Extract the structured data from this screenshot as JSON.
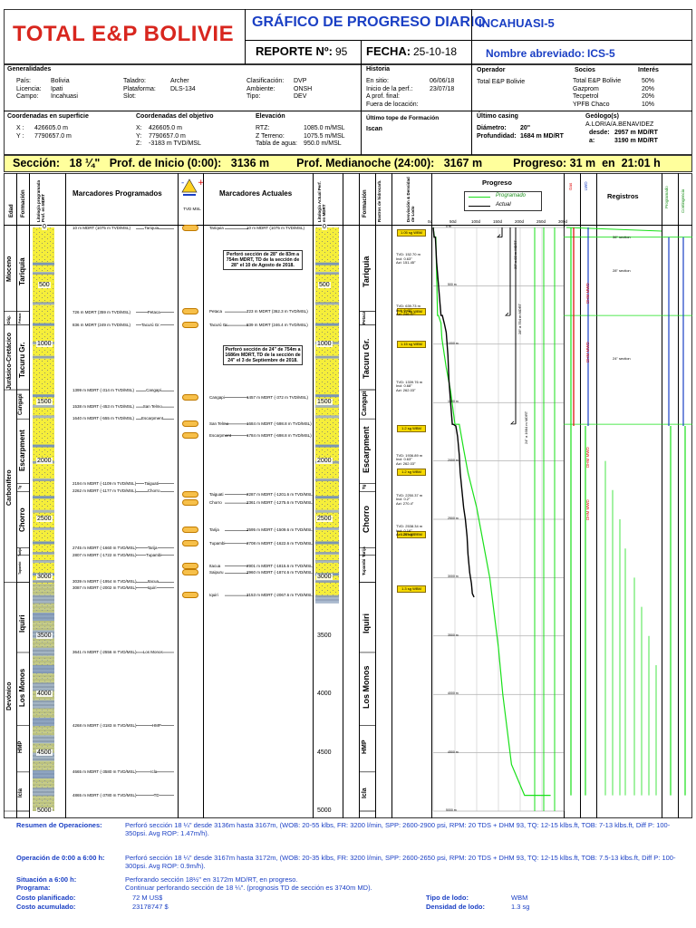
{
  "header": {
    "company": "TOTAL E&P BOLIVIE",
    "title": "GRÁFICO DE PROGRESO DIARIO",
    "well": "INCAHUASI-5",
    "report_label": "REPORTE Nº:",
    "report_no": "95",
    "date_label": "FECHA:",
    "date": "25-10-18",
    "short_name_label": "Nombre abreviado:",
    "short_name": "ICS-5"
  },
  "generalidades": {
    "title": "Generalidades",
    "rows": [
      [
        "País:",
        "Bolivia",
        "Taladro:",
        "Archer",
        "Clasificación:",
        "DVP"
      ],
      [
        "Licencia:",
        "Ipati",
        "Plataforma:",
        "DLS-134",
        "Ambiente:",
        "ONSH"
      ],
      [
        "Campo:",
        "Incahuasi",
        "Slot:",
        "",
        "Tipo:",
        "DEV"
      ]
    ]
  },
  "historia": {
    "title": "Historia",
    "rows": [
      [
        "En sitio:",
        "06/06/18"
      ],
      [
        "Inicio de la perf.:",
        "23/07/18"
      ],
      [
        "A prof. final:",
        ""
      ],
      [
        "Fuera de locación:",
        ""
      ]
    ]
  },
  "operador": {
    "title": "Operador",
    "value": "Total E&P Bolivie"
  },
  "socios": {
    "title": "Socios",
    "interes_title": "Interés",
    "rows": [
      [
        "Total E&P Bolivie",
        "50%"
      ],
      [
        "Gazprom",
        "20%"
      ],
      [
        "Tecpetrol",
        "20%"
      ],
      [
        "YPFB Chaco",
        "10%"
      ]
    ]
  },
  "coords": {
    "surface_title": "Coordenadas en superficie",
    "surface": [
      [
        "X :",
        "426605.0 m"
      ],
      [
        "Y :",
        "7790657.0 m"
      ]
    ],
    "target_title": "Coordenadas del objetivo",
    "target": [
      [
        "X:",
        "426605.0 m"
      ],
      [
        "Y:",
        "7790657.0 m"
      ],
      [
        "Z:",
        "-3183 m TVD/MSL"
      ]
    ],
    "elev_title": "Elevación",
    "elev": [
      [
        "RTZ:",
        "1085.0 m/MSL"
      ],
      [
        "Z Terreno:",
        "1075.5 m/MSL"
      ],
      [
        "Tabla de agua:",
        "950.0 m/MSL"
      ]
    ],
    "last_top_title": "Último tope de Formación",
    "last_top": "Iscan",
    "casing_title": "Último casing",
    "casing": [
      [
        "Diámetro:",
        "20\""
      ],
      [
        "Profundidad:",
        "1684 m MD/RT"
      ]
    ],
    "geo_title": "Geólogo(s)",
    "geo_name": "A.LORIA/A.BENAVIDEZ",
    "geo": [
      [
        "desde:",
        "2957 m MD/RT"
      ],
      [
        "a:",
        "3190 m MD/RT"
      ]
    ]
  },
  "status_bar": {
    "section_label": "Sección:",
    "section": "18 ¼\"",
    "start_label": "Prof. de Inicio (0:00):",
    "start": "3136 m",
    "midnight_label": "Prof. Medianoche (24:00):",
    "midnight": "3167 m",
    "progress_label": "Progreso:",
    "progress": "31 m",
    "at_label": "en",
    "at": "21:01 h"
  },
  "columns": {
    "edad": "Edad",
    "formacion": "Formación",
    "litologia": "Litología programada Prof. en MDRT",
    "marcadores_prog": "Marcadores Programados",
    "tvd": "TVD MSL",
    "marcadores_act": "Marcadores Actuales",
    "litologia_act": "Litología Actual Perf. en MDRT",
    "formacion2": "Formación",
    "rastros": "Rastros de hidrocarb.",
    "desviacion": "Desviación & Densidad de Lodo",
    "progreso": "Progreso",
    "legend_prog": "Programado",
    "legend_act": "Actual",
    "registros": "Registros",
    "gas": "Gas",
    "lwd": "LWD",
    "nml": "NML",
    "programado_v": "Programado",
    "contingencia_v": "Contingencia"
  },
  "days_axis": [
    "0d",
    "50d",
    "100d",
    "150d",
    "200d",
    "250d",
    "300d"
  ],
  "depth_ticks": [
    "0",
    "500",
    "1000",
    "1500",
    "2000",
    "2500",
    "3000",
    "3500",
    "4000",
    "4500",
    "5000"
  ],
  "ages": [
    {
      "name": "Mioceno",
      "top": 0,
      "bot": 720
    },
    {
      "name": "Olig.",
      "top": 720,
      "bot": 836
    },
    {
      "name": "Jurásico-Cretácico",
      "top": 836,
      "bot": 1390
    },
    {
      "name": "Carbonífero",
      "top": 1390,
      "bot": 3039
    },
    {
      "name": "Devónico",
      "top": 3039,
      "bot": 5000
    }
  ],
  "formations": [
    {
      "name": "Tariquia",
      "top": 0,
      "bot": 720
    },
    {
      "name": "Petaca",
      "top": 720,
      "bot": 836
    },
    {
      "name": "Tacuru Gr.",
      "top": 836,
      "bot": 1390
    },
    {
      "name": "Cangapi",
      "top": 1390,
      "bot": 1640
    },
    {
      "name": "Escarpment",
      "top": 1640,
      "bot": 2194
    },
    {
      "name": "Tg",
      "top": 2194,
      "bot": 2262
    },
    {
      "name": "Chorro",
      "top": 2262,
      "bot": 2745
    },
    {
      "name": "Tarija",
      "top": 2745,
      "bot": 2807
    },
    {
      "name": "Tupambi",
      "top": 2807,
      "bot": 3039
    },
    {
      "name": "Iquiri",
      "top": 3087,
      "bot": 3641
    },
    {
      "name": "Los Monos",
      "top": 3641,
      "bot": 4268
    },
    {
      "name": "HMP",
      "top": 4268,
      "bot": 4665
    },
    {
      "name": "Icla",
      "top": 4665,
      "bot": 5000
    }
  ],
  "prog_markers": [
    {
      "d": 10,
      "text": "10 m MDRT (1075 m TVD/MSL)",
      "name": "Tariquia"
    },
    {
      "d": 726,
      "text": "726 m MDRT (359 m TVD/MSL)",
      "name": "Petaca"
    },
    {
      "d": 836,
      "text": "836 m MDRT (249 m TVD/MSL)",
      "name": "Tacurú Gr."
    },
    {
      "d": 1399,
      "text": "1399 m MDRT (-314 m TVD/MSL)",
      "name": "Cangapi"
    },
    {
      "d": 1538,
      "text": "1538 m MDRT (-453 m TVD/MSL)",
      "name": "San Telmo"
    },
    {
      "d": 1640,
      "text": "1640 m MDRT (-555 m TVD/MSL)",
      "name": "Escarpment"
    },
    {
      "d": 2194,
      "text": "2194 m MDRT (-1109 m TVD/MSL)",
      "name": "Taiguati"
    },
    {
      "d": 2262,
      "text": "2262 m MDRT (-1177 m TVD/MSL)",
      "name": "Chorro"
    },
    {
      "d": 2745,
      "text": "2745 m MDRT (-1660 m TVD/MSL)",
      "name": "Tarija"
    },
    {
      "d": 2807,
      "text": "2807 m MDRT (-1722 m TVD/MSL)",
      "name": "Tupambi"
    },
    {
      "d": 3039,
      "text": "3039 m MDRT (-1954 m TVD/MSL)",
      "name": "Itacua"
    },
    {
      "d": 3087,
      "text": "3087 m MDRT (-2002 m TVD/MSL)",
      "name": "Iquiri"
    },
    {
      "d": 3641,
      "text": "3641 m MDRT (-2556 m TVD/MSL)",
      "name": "Los Monos"
    },
    {
      "d": 4268,
      "text": "4268 m MDRT (-3183 m TVD/MSL)",
      "name": "HMP"
    },
    {
      "d": 4665,
      "text": "4665 m MDRT (-3580 m TVD/MSL)",
      "name": "Icla"
    },
    {
      "d": 4865,
      "text": "4865 m MDRT (-3780 m TVD/MSL)",
      "name": "TD"
    }
  ],
  "act_markers": [
    {
      "d": 10,
      "name": "Tariquia",
      "text": "10 m MDRT (1075 m TVD/MSL)"
    },
    {
      "d": 723,
      "name": "Petaca",
      "text": "723 m MDRT (362.3 m TVD/MSL)"
    },
    {
      "d": 839,
      "name": "Tacurú Gr.",
      "text": "839 m MDRT (246.4 m TVD/MSL)"
    },
    {
      "d": 1457,
      "name": "Cangapi",
      "text": "1457 m MDRT (-372 m TVD/MSL)"
    },
    {
      "d": 1684,
      "name": "San Telmo",
      "text": "1684 m MDRT (-598.8 m TVD/MSL)"
    },
    {
      "d": 1784,
      "name": "Escarpment",
      "text": "1784 m MDRT (-698.8 m TVD/MSL)"
    },
    {
      "d": 2287,
      "name": "Taiguati",
      "text": "2287 m MDRT (-1201.6 m TVD/MSL)"
    },
    {
      "d": 2361,
      "name": "Chorro",
      "text": "2361 m MDRT (-1275.6 m TVD/MSL)"
    },
    {
      "d": 2595,
      "name": "Tarija",
      "text": "2595 m MDRT (-1509.6 m TVD/MSL)"
    },
    {
      "d": 2708,
      "name": "Tupambi",
      "text": "2708 m MDRT (-1622.6 m TVD/MSL)"
    },
    {
      "d": 2901,
      "name": "Itacua",
      "text": "2901 m MDRT (-1815.6 m TVD/MSL)"
    },
    {
      "d": 2960,
      "name": "Saipuru",
      "text": "2960 m MDRT (-1874.6 m TVD/MSL)"
    },
    {
      "d": 3153,
      "name": "Iquiri",
      "text": "3153 m MDRT (-2067.6 m TVD/MSL)"
    }
  ],
  "notes": [
    {
      "d": 330,
      "text": "Perforó sección de 28\" de 83m a 754m MDRT, TD de la sección de 28\" el 10 de Agosto de 2018."
    },
    {
      "d": 1150,
      "text": "Perforó sección de 24\" de 754m a 1686m MDRT, TD de la sección de 24\" el 3 de Septiembre de 2018."
    }
  ],
  "mud_weights": [
    {
      "d": 50,
      "label": "1.05 sg WBM"
    },
    {
      "d": 720,
      "label": "1.12 sg WBM"
    },
    {
      "d": 1000,
      "label": "1.15 sg WBM"
    },
    {
      "d": 1720,
      "label": "1.2 sg WBM"
    },
    {
      "d": 2100,
      "label": "1.2 sg WBM"
    },
    {
      "d": 2630,
      "label": "1.27 sg WBM"
    },
    {
      "d": 3100,
      "label": "1.3 sg WBM"
    }
  ],
  "surveys": [
    {
      "d": 220,
      "lines": [
        "TVD: 152.70 m",
        "Incl: 0.63°",
        "Azi: 151.45°"
      ]
    },
    {
      "d": 660,
      "lines": [
        "TVD: 639.73 m",
        "Incl: 0.45°",
        "Azi: 246.07°"
      ]
    },
    {
      "d": 1310,
      "lines": [
        "TVD: 1339.76 m",
        "Incl: 0.68°",
        "Azi: 262.03°"
      ]
    },
    {
      "d": 1940,
      "lines": [
        "TVD: 1936.89 m",
        "Incl: 0.63°",
        "Azi: 262.03°"
      ]
    },
    {
      "d": 2280,
      "lines": [
        "TVD: 2250.37 m",
        "Incl: 0.2°",
        "Azi: 270.4°"
      ]
    },
    {
      "d": 2550,
      "lines": [
        "TVD: 2538.34 m",
        "Incl: 0.16°",
        "Azi: 264.01°"
      ]
    }
  ],
  "casing_labels": [
    {
      "d": 200,
      "text": "30\" a 83 m MDRT"
    },
    {
      "d": 760,
      "text": "28\" a 754 m MDRT"
    },
    {
      "d": 1700,
      "text": "24\" a 1684 m MDRT"
    }
  ],
  "chart_data": {
    "type": "line",
    "title": "Progreso",
    "xlabel": "",
    "ylabel": "",
    "xlim": [
      0,
      300
    ],
    "ylim": [
      5000,
      0
    ],
    "series": [
      {
        "name": "Programado",
        "color": "#19e019",
        "x": [
          0,
          3,
          6,
          10,
          12,
          18,
          20,
          30,
          40,
          50,
          60,
          70,
          80,
          100,
          110,
          120,
          130,
          140,
          150,
          160,
          170,
          180,
          210,
          270
        ],
        "y": [
          0,
          83,
          83,
          754,
          754,
          820,
          950,
          1200,
          1400,
          1686,
          1686,
          1900,
          2100,
          2400,
          2600,
          2800,
          3000,
          3300,
          3600,
          4000,
          4300,
          4600,
          4865,
          4865
        ]
      },
      {
        "name": "Actual",
        "color": "#000000",
        "x": [
          0,
          2,
          5,
          8,
          18,
          21,
          26,
          30,
          34,
          36,
          40,
          44,
          46,
          52,
          56,
          60,
          62,
          66,
          70,
          74,
          78,
          80,
          84,
          88,
          90,
          94
        ],
        "y": [
          0,
          83,
          83,
          300,
          754,
          754,
          830,
          900,
          1100,
          1300,
          1500,
          1686,
          1686,
          1700,
          1790,
          1950,
          2100,
          2250,
          2400,
          2500,
          2650,
          2800,
          2957,
          3050,
          3136,
          3167
        ]
      }
    ]
  },
  "registros_labels": [
    {
      "text": "36\" section",
      "d": 60
    },
    {
      "text": "28\" section",
      "d": 350
    },
    {
      "text": "24\" section",
      "d": 1100
    },
    {
      "text": "DHM MWD",
      "d": 500
    },
    {
      "text": "DHM MWD",
      "d": 1000
    },
    {
      "text": "DHM MWD",
      "d": 1900
    },
    {
      "text": "DHM MWD",
      "d": 2350
    }
  ],
  "summary": {
    "resumen_label": "Resumen de Operaciones:",
    "resumen": "Perforó sección 18 ¼\" desde 3136m hasta 3167m, (WOB: 20-55 klbs, FR: 3200 l/min, SPP: 2600-2900 psi, RPM: 20 TDS + DHM 93, TQ: 12-15 klbs.ft, TOB: 7-13 klbs.ft, Diff P: 100-350psi. Avg ROP: 1.47m/h).",
    "op_label": "Operación de 0:00 a 6:00 h:",
    "op": "Perforó sección 18 ¼\" desde 3167m hasta 3172m, (WOB: 20-35 klbs, FR: 3200 l/min, SPP: 2600-2650 psi, RPM: 20 TDS + DHM 93, TQ: 12-15 klbs.ft, TOB: 7.5-13 klbs.ft, Diff P: 100-300psi. Avg ROP: 0.9m/h).",
    "situacion_label": "Situación a 6:00 h:",
    "situacion": "Perforando sección 18½\" en 3172m MD/RT, en progreso.",
    "programa_label": "Programa:",
    "programa": "Continuar perforando sección de 18 ¼\". (prognosis TD de sección es 3740m MD).",
    "costo_plan_label": "Costo planificado:",
    "costo_plan": "72 M US$",
    "costo_acum_label": "Costo acumulado:",
    "costo_acum": "23178747 $",
    "tipo_lodo_label": "Tipo de lodo:",
    "tipo_lodo": "WBM",
    "densidad_label": "Densidad de lodo:",
    "densidad": "1.3 sg"
  }
}
